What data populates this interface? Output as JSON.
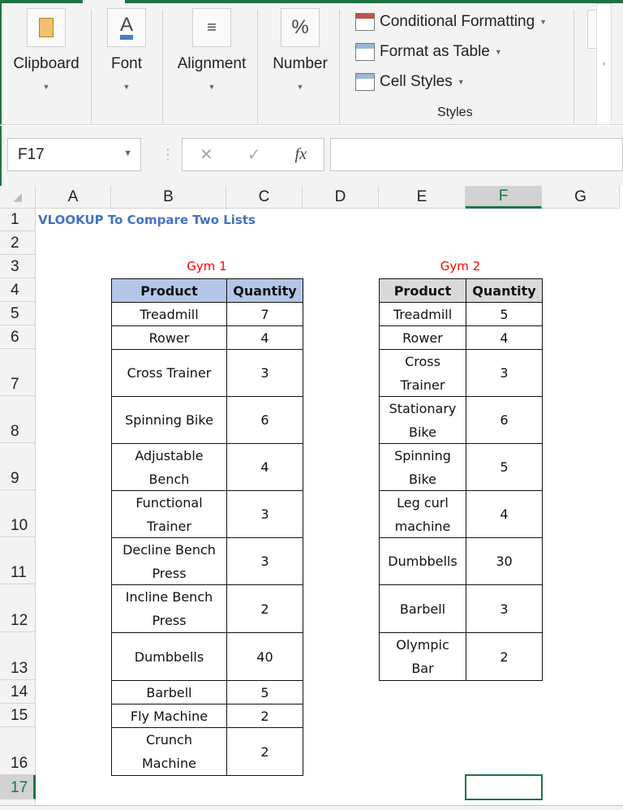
{
  "ribbon": {
    "groups": [
      {
        "label": "Clipboard",
        "icon": "clipboard-icon"
      },
      {
        "label": "Font",
        "icon": "font-color-icon"
      },
      {
        "label": "Alignment",
        "icon": "align-icon"
      },
      {
        "label": "Number",
        "icon": "percent-icon",
        "glyph": "%"
      }
    ],
    "styles": {
      "items": [
        "Conditional Formatting",
        "Format as Table",
        "Cell Styles"
      ],
      "group_label": "Styles"
    }
  },
  "formula_bar": {
    "name_box": "F17",
    "cancel": "✕",
    "enter": "✓",
    "fx": "fx",
    "value": ""
  },
  "columns": [
    "A",
    "B",
    "C",
    "D",
    "E",
    "F",
    "G"
  ],
  "rows": [
    "1",
    "2",
    "3",
    "4",
    "5",
    "6",
    "7",
    "8",
    "9",
    "10",
    "11",
    "12",
    "13",
    "14",
    "15",
    "16",
    "17"
  ],
  "selected_cell": "F17",
  "sheet": {
    "title": "VLOOKUP To Compare Two Lists",
    "gym1": {
      "title": "Gym 1",
      "header": [
        "Product",
        "Quantity"
      ],
      "header_color": "#b4c6e7",
      "rows": [
        [
          "Treadmill",
          "7"
        ],
        [
          "Rower",
          "4"
        ],
        [
          "Cross Trainer",
          "3"
        ],
        [
          "Spinning Bike",
          "6"
        ],
        [
          "Adjustable\nBench",
          "4"
        ],
        [
          "Functional\nTrainer",
          "3"
        ],
        [
          "Decline Bench\nPress",
          "3"
        ],
        [
          "Incline Bench\nPress",
          "2"
        ],
        [
          "Dumbbells",
          "40"
        ],
        [
          "Barbell",
          "5"
        ],
        [
          "Fly Machine",
          "2"
        ],
        [
          "Crunch\nMachine",
          "2"
        ]
      ]
    },
    "gym2": {
      "title": "Gym 2",
      "header": [
        "Product",
        "Quantity"
      ],
      "header_color": "#d9d9d9",
      "rows": [
        [
          "Treadmill",
          "5"
        ],
        [
          "Rower",
          "4"
        ],
        [
          "Cross\nTrainer",
          "3"
        ],
        [
          "Stationary\nBike",
          "6"
        ],
        [
          "Spinning\nBike",
          "5"
        ],
        [
          "Leg curl\nmachine",
          "4"
        ],
        [
          "Dumbbells",
          "30"
        ],
        [
          "Barbell",
          "3"
        ],
        [
          "Olympic\nBar",
          "2"
        ]
      ]
    }
  }
}
